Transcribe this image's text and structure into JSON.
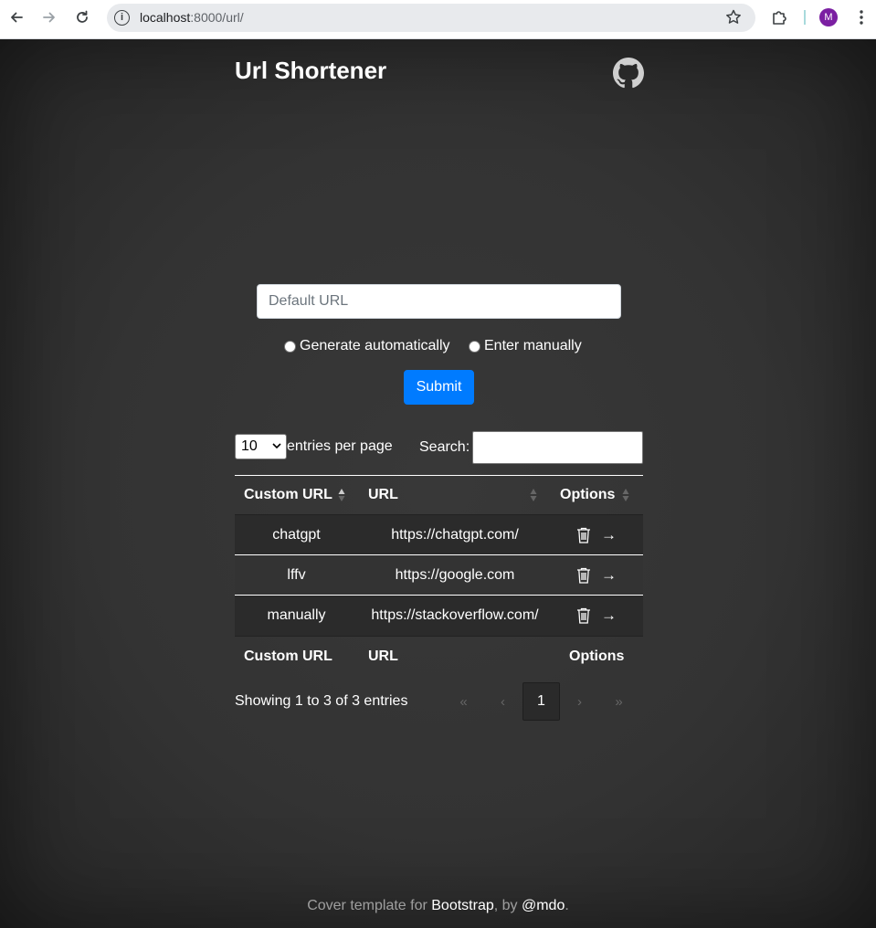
{
  "browser": {
    "url_host": "localhost",
    "url_rest": ":8000/url/",
    "avatar_letter": "M"
  },
  "header": {
    "title": "Url Shortener"
  },
  "form": {
    "url_placeholder": "Default URL",
    "radio_auto": "Generate automatically",
    "radio_manual": "Enter manually",
    "submit_label": "Submit"
  },
  "table_controls": {
    "per_page_value": "10",
    "per_page_label": "entries per page",
    "search_label": "Search:"
  },
  "table": {
    "headers": [
      "Custom URL",
      "URL",
      "Options"
    ],
    "rows": [
      {
        "custom": "chatgpt",
        "url": "https://chatgpt.com/"
      },
      {
        "custom": "lffv",
        "url": "https://google.com"
      },
      {
        "custom": "manually",
        "url": "https://stackoverflow.com/"
      }
    ],
    "footers": [
      "Custom URL",
      "URL",
      "Options"
    ]
  },
  "pagination": {
    "info": "Showing 1 to 3 of 3 entries",
    "first": "«",
    "prev": "‹",
    "current": "1",
    "next": "›",
    "last": "»"
  },
  "footer": {
    "pre": "Cover template for ",
    "bootstrap": "Bootstrap",
    "mid": ", by ",
    "author": "@mdo",
    "post": "."
  },
  "colors": {
    "accent": "#007bff",
    "background": "#333333"
  }
}
